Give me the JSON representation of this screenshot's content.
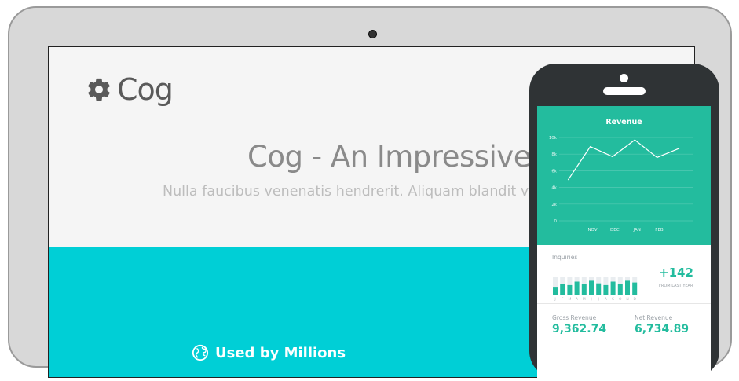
{
  "site": {
    "logo_text": "Cog",
    "hero_title": "Cog - An Impressive F",
    "hero_subtitle": "Nulla faucibus venenatis hendrerit. Aliquam blandit veh",
    "used_by": "Used by Millions"
  },
  "phone": {
    "revenue": {
      "title": "Revenue"
    },
    "inquiries": {
      "label": "Inquiries",
      "value": "+142",
      "sub": "FROM LAST YEAR"
    },
    "gross": {
      "label": "Gross Revenue",
      "value": "9,362.74"
    },
    "net": {
      "label": "Net Revenue",
      "value": "6,734.89"
    }
  },
  "colors": {
    "teal_band": "#00cfd6",
    "phone_green": "#23bc9e"
  },
  "chart_data": [
    {
      "type": "line",
      "title": "Revenue",
      "y_ticks": [
        "0",
        "2k",
        "4k",
        "6k",
        "8k",
        "10k"
      ],
      "ylim": [
        0,
        10000
      ],
      "categories": [
        "NOV",
        "DEC",
        "JAN",
        "FEB"
      ],
      "x": [
        0,
        1,
        2,
        3,
        4,
        5,
        6
      ],
      "x_tick_positions": [
        1.5,
        2.5,
        3.5,
        4.5
      ],
      "values": [
        4900,
        8900,
        7700,
        9700,
        7600,
        8700
      ],
      "grid": true
    },
    {
      "type": "bar",
      "title": "Inquiries",
      "categories": [
        "J",
        "F",
        "M",
        "A",
        "M",
        "J",
        "J",
        "A",
        "S",
        "O",
        "N",
        "D"
      ],
      "values": [
        0.45,
        0.6,
        0.55,
        0.75,
        0.6,
        0.8,
        0.65,
        0.55,
        0.75,
        0.6,
        0.8,
        0.7
      ],
      "max": 1
    }
  ]
}
